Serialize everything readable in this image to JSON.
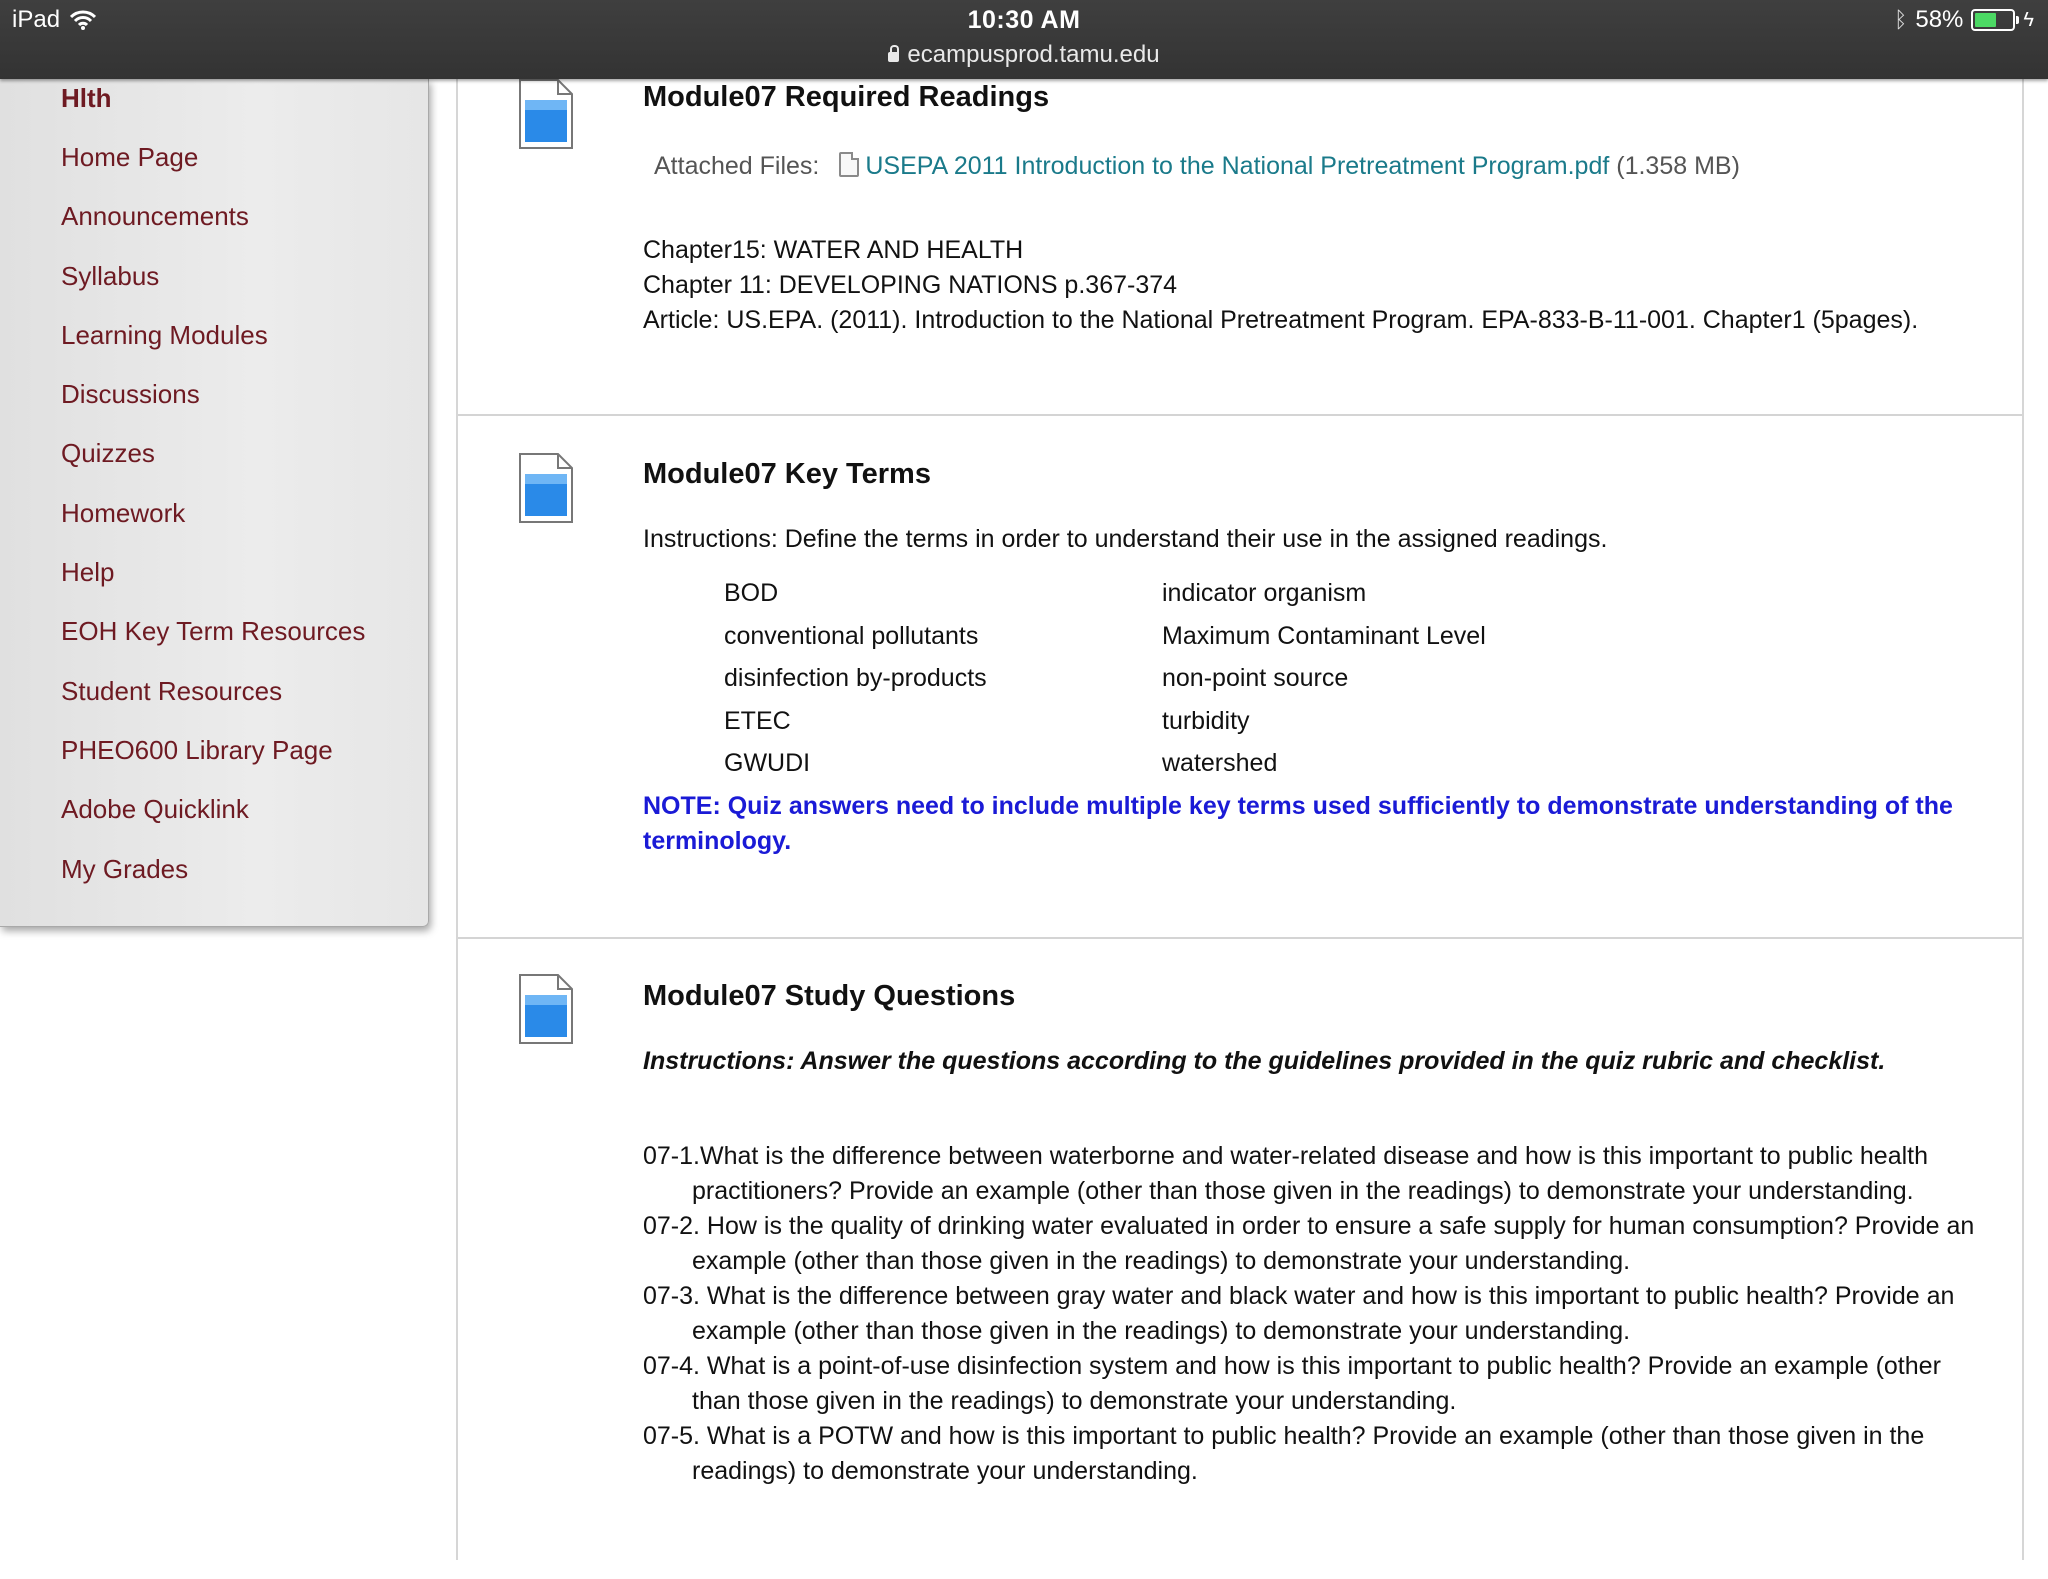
{
  "status_bar": {
    "device": "iPad",
    "time": "10:30 AM",
    "url": "ecampusprod.tamu.edu",
    "battery": "58%",
    "battery_level": 0.58
  },
  "sidebar": {
    "course_title": "Hlth",
    "items": [
      {
        "label": "Home Page"
      },
      {
        "label": "Announcements"
      },
      {
        "label": "Syllabus"
      },
      {
        "label": "Learning Modules"
      },
      {
        "label": "Discussions"
      },
      {
        "label": "Quizzes"
      },
      {
        "label": "Homework"
      },
      {
        "label": "Help"
      },
      {
        "label": "EOH Key Term Resources"
      },
      {
        "label": "Student Resources"
      },
      {
        "label": "PHEO600 Library Page"
      },
      {
        "label": "Adobe Quicklink"
      },
      {
        "label": "My Grades"
      }
    ]
  },
  "readings": {
    "title": "Module07 Required Readings",
    "attached_label": "Attached Files:",
    "file_name": "USEPA 2011 Introduction to the National Pretreatment Program.pdf",
    "file_size": "(1.358 MB)",
    "lines": [
      "Chapter15: WATER AND HEALTH",
      "Chapter 11: DEVELOPING NATIONS p.367-374",
      "Article: US.EPA. (2011). Introduction to the National Pretreatment Program. EPA-833-B-11-001. Chapter1 (5pages)."
    ]
  },
  "key_terms": {
    "title": "Module07 Key Terms",
    "instructions": "Instructions: Define the terms in order to understand their use in the assigned readings.",
    "terms_left": [
      "BOD",
      "conventional pollutants",
      "disinfection by-products",
      "ETEC",
      "GWUDI"
    ],
    "terms_right": [
      "indicator organism",
      "Maximum Contaminant Level",
      "non-point source",
      "turbidity",
      "watershed"
    ],
    "note": "NOTE: Quiz answers need to include multiple key terms used sufficiently to demonstrate understanding of the terminology."
  },
  "study_questions": {
    "title": "Module07 Study Questions",
    "instructions": "Instructions: Answer the questions according to the guidelines provided in the quiz rubric and checklist.",
    "questions": [
      "07-1.What is the difference between waterborne and water-related disease and how is this important to public health practitioners? Provide an example (other than those given in the readings) to demonstrate your understanding.",
      "07-2. How is the quality of drinking water evaluated in order to ensure a safe supply for human consumption? Provide an example (other than those given in the readings) to demonstrate your understanding.",
      "07-3. What is the difference between gray water and black water and how is this important to public health? Provide an example (other than those given in the readings) to demonstrate your understanding.",
      "07-4. What is a point-of-use disinfection system and how is this important to public health? Provide an example (other than those given in the readings) to demonstrate your understanding.",
      "07-5. What is a POTW and how is this important to public health? Provide an example (other than those given in the readings) to demonstrate your understanding."
    ]
  }
}
